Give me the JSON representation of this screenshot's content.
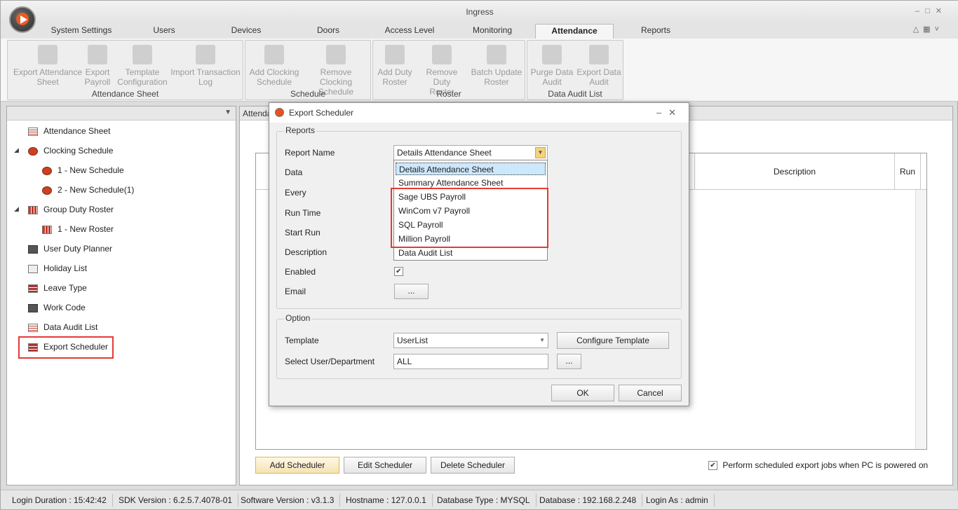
{
  "window": {
    "title": "Ingress"
  },
  "tabs": [
    "System Settings",
    "Users",
    "Devices",
    "Doors",
    "Access Level",
    "Monitoring",
    "Attendance",
    "Reports"
  ],
  "active_tab": "Attendance",
  "ribbon": {
    "groups": [
      {
        "label": "Attendance Sheet",
        "buttons": [
          "Export Attendance Sheet",
          "Export Payroll",
          "Template Configuration",
          "Import Transaction Log"
        ]
      },
      {
        "label": "Schedule",
        "buttons": [
          "Add Clocking Schedule",
          "Remove Clocking Schedule"
        ]
      },
      {
        "label": "Roster",
        "buttons": [
          "Add Duty Roster",
          "Remove Duty Roster",
          "Batch Update Roster"
        ]
      },
      {
        "label": "Data Audit List",
        "buttons": [
          "Purge Data Audit",
          "Export Data Audit"
        ]
      }
    ],
    "btn_lines": {
      "export_attendance": [
        "Export Attendance",
        "Sheet"
      ],
      "export_payroll": [
        "Export",
        "Payroll"
      ],
      "template_config": [
        "Template",
        "Configuration"
      ],
      "import_log": [
        "Import Transaction",
        "Log"
      ],
      "add_clocking": [
        "Add Clocking",
        "Schedule"
      ],
      "remove_clocking": [
        "Remove Clocking",
        "Schedule"
      ],
      "add_roster": [
        "Add Duty",
        "Roster"
      ],
      "remove_roster": [
        "Remove Duty",
        "Roster"
      ],
      "batch_roster": [
        "Batch Update",
        "Roster"
      ],
      "purge_audit": [
        "Purge Data",
        "Audit"
      ],
      "export_audit": [
        "Export Data",
        "Audit"
      ]
    }
  },
  "tree": {
    "items": [
      {
        "label": "Attendance Sheet",
        "icon": "sheet-icon"
      },
      {
        "label": "Clocking Schedule",
        "icon": "clock-icon"
      },
      {
        "label": "1 - New Schedule",
        "icon": "clock-icon"
      },
      {
        "label": "2 - New Schedule(1)",
        "icon": "clock-icon"
      },
      {
        "label": "Group Duty Roster",
        "icon": "roster-icon"
      },
      {
        "label": "1 - New Roster",
        "icon": "roster-icon"
      },
      {
        "label": "User Duty Planner",
        "icon": "briefcase-icon"
      },
      {
        "label": "Holiday List",
        "icon": "flipflop-icon"
      },
      {
        "label": "Leave Type",
        "icon": "calendar-icon"
      },
      {
        "label": "Work Code",
        "icon": "chat-icon"
      },
      {
        "label": "Data Audit List",
        "icon": "sheet-icon"
      },
      {
        "label": "Export Scheduler",
        "icon": "calendar-icon"
      }
    ]
  },
  "right_panel": {
    "tab_title": "Attenda",
    "grid_columns": [
      "Description",
      "Run"
    ],
    "buttons": {
      "add": "Add Scheduler",
      "edit": "Edit Scheduler",
      "delete": "Delete Scheduler"
    },
    "perform_label": "Perform scheduled export jobs when PC is powered on"
  },
  "dialog": {
    "title": "Export Scheduler",
    "reports_group": "Reports",
    "labels": {
      "report_name": "Report Name",
      "data": "Data",
      "every": "Every",
      "run_time": "Run Time",
      "start_run": "Start Run",
      "description": "Description",
      "enabled": "Enabled",
      "email": "Email"
    },
    "report_name_value": "Details Attendance Sheet",
    "email_button": "...",
    "dropdown_options": [
      "Details Attendance Sheet",
      "Summary Attendance Sheet",
      "Sage UBS Payroll",
      "WinCom v7 Payroll",
      "SQL Payroll",
      "Million Payroll",
      "Data Audit List"
    ],
    "option_group": "Option",
    "template_label": "Template",
    "template_value": "UserList",
    "configure_template": "Configure Template",
    "select_user_label": "Select User/Department",
    "select_user_value": "ALL",
    "select_user_button": "...",
    "ok": "OK",
    "cancel": "Cancel"
  },
  "status_bar": [
    "Login Duration : 15:42:42",
    "SDK Version : 6.2.5.7.4078-01",
    "Software Version : v3.1.3",
    "Hostname : 127.0.0.1",
    "Database Type : MYSQL",
    "Database : 192.168.2.248",
    "Login As : admin"
  ]
}
